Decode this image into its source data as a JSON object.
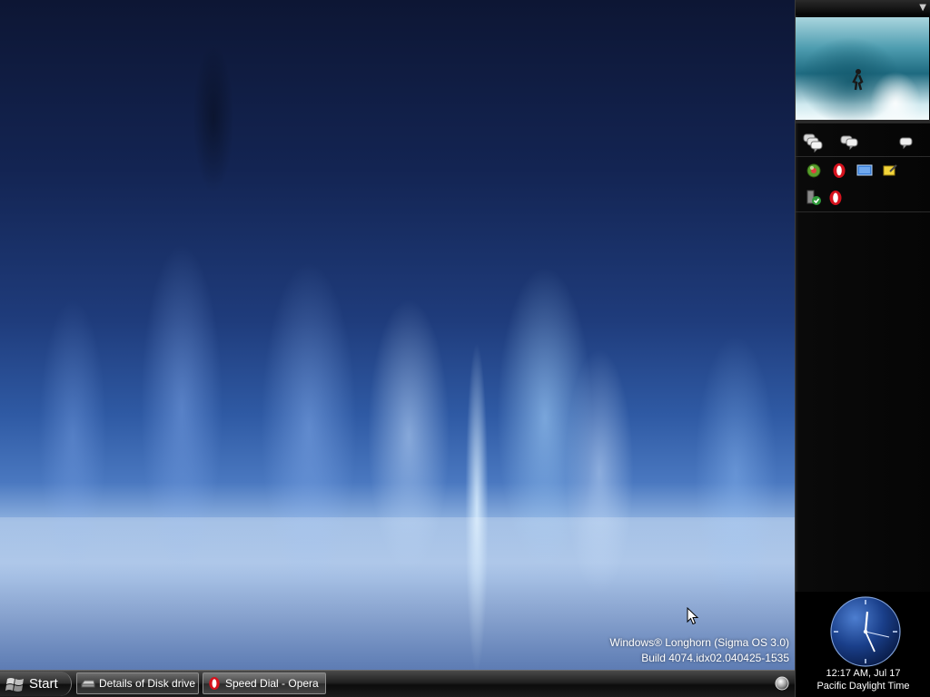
{
  "watermark": {
    "line1": "Windows® Longhorn (Sigma OS 3.0)",
    "line2": "Build 4074.idx02.040425-1535"
  },
  "taskbar": {
    "start_label": "Start",
    "tasks": [
      {
        "label": "Details of Disk drive",
        "icon": "disk-drive-icon"
      },
      {
        "label": "Speed Dial - Opera",
        "icon": "opera-icon"
      }
    ],
    "tray_icon": "notification-orb-icon"
  },
  "sidebar": {
    "menu_icon": "chevron-down-icon",
    "slideshow_image": "surfing-wave-photo",
    "rows": [
      [
        "chat-bubbles-icon",
        "chat-bubble-icon",
        "chat-small-icon"
      ],
      [
        "green-globe-icon",
        "opera-icon",
        "monitor-icon",
        "sticky-note-icon"
      ],
      [
        "security-shield-icon",
        "opera-icon"
      ]
    ]
  },
  "clock": {
    "time_date": "12:17 AM, Jul 17",
    "zone": "Pacific Daylight Time"
  },
  "colors": {
    "opera_red": "#d5121d",
    "taskbar_dark": "#0c0c0c",
    "sidebar_bg": "#050505"
  }
}
